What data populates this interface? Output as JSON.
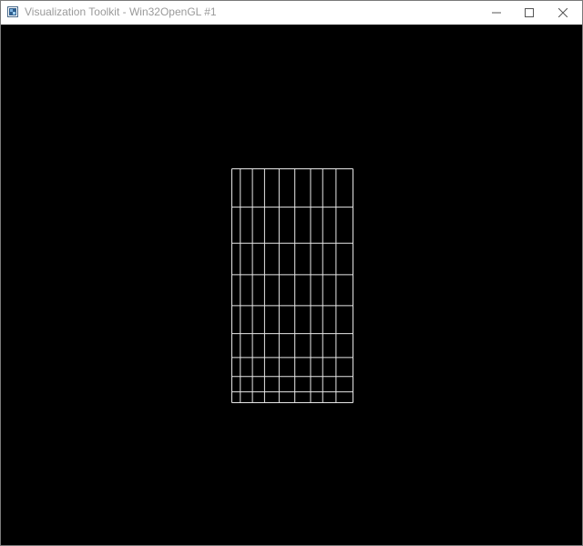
{
  "window": {
    "title": "Visualization Toolkit - Win32OpenGL #1",
    "controls": {
      "minimize_icon": "minimize-icon",
      "maximize_icon": "maximize-icon",
      "close_icon": "close-icon"
    }
  },
  "viewport": {
    "background": "#000000",
    "mesh": {
      "line_color": "#e6e6e6",
      "columns": 9,
      "rows": 9,
      "column_fractions": [
        0,
        0.07,
        0.17,
        0.27,
        0.39,
        0.52,
        0.65,
        0.75,
        0.86,
        1.0
      ],
      "row_fractions": [
        0,
        0.164,
        0.318,
        0.453,
        0.585,
        0.705,
        0.807,
        0.888,
        0.954,
        1.0
      ]
    }
  }
}
